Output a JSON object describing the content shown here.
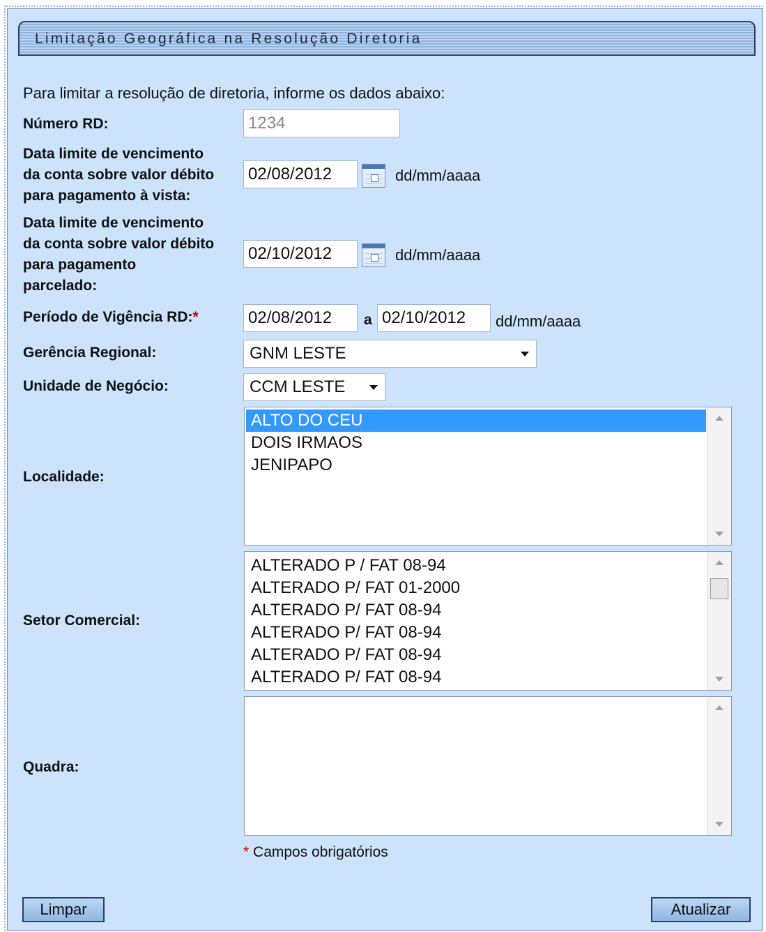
{
  "title": "Limitação Geográfica na Resolução Diretoria",
  "intro": "Para limitar a resolução de diretoria, informe os dados abaixo:",
  "numero_rd": {
    "label": "Número RD:",
    "value": "1234"
  },
  "data_avista": {
    "label_lines": [
      "Data limite de vencimento",
      "da conta sobre valor débito",
      "para pagamento à vista:"
    ],
    "value": "02/08/2012",
    "format": "dd/mm/aaaa"
  },
  "data_parcelado": {
    "label_lines": [
      "Data limite de vencimento",
      "da conta sobre valor débito",
      "para pagamento",
      "parcelado:"
    ],
    "value": "02/10/2012",
    "format": "dd/mm/aaaa"
  },
  "periodo": {
    "label": "Período de Vigência RD:",
    "required_mark": "*",
    "start": "02/08/2012",
    "separator": "a",
    "end": "02/10/2012",
    "format": "dd/mm/aaaa"
  },
  "gerencia": {
    "label": "Gerência Regional:",
    "selected": "GNM LESTE"
  },
  "unidade": {
    "label": "Unidade de Negócio:",
    "selected": "CCM LESTE"
  },
  "localidade": {
    "label": "Localidade:",
    "items": [
      "ALTO DO CEU",
      "DOIS IRMAOS",
      "JENIPAPO"
    ],
    "selected": "ALTO DO CEU"
  },
  "setor": {
    "label": "Setor Comercial:",
    "items": [
      "ALTERADO P / FAT 08-94",
      "ALTERADO P/ FAT 01-2000",
      "ALTERADO P/ FAT 08-94",
      "ALTERADO P/ FAT 08-94",
      "ALTERADO P/ FAT 08-94",
      "ALTERADO P/ FAT 08-94"
    ]
  },
  "quadra": {
    "label": "Quadra:",
    "items": []
  },
  "required_note": {
    "mark": "*",
    "text": " Campos obrigatórios"
  },
  "buttons": {
    "limpar": "Limpar",
    "atualizar": "Atualizar"
  },
  "icons": {
    "calendar": "calendar-icon",
    "dropdown": "chevron-down-icon"
  }
}
